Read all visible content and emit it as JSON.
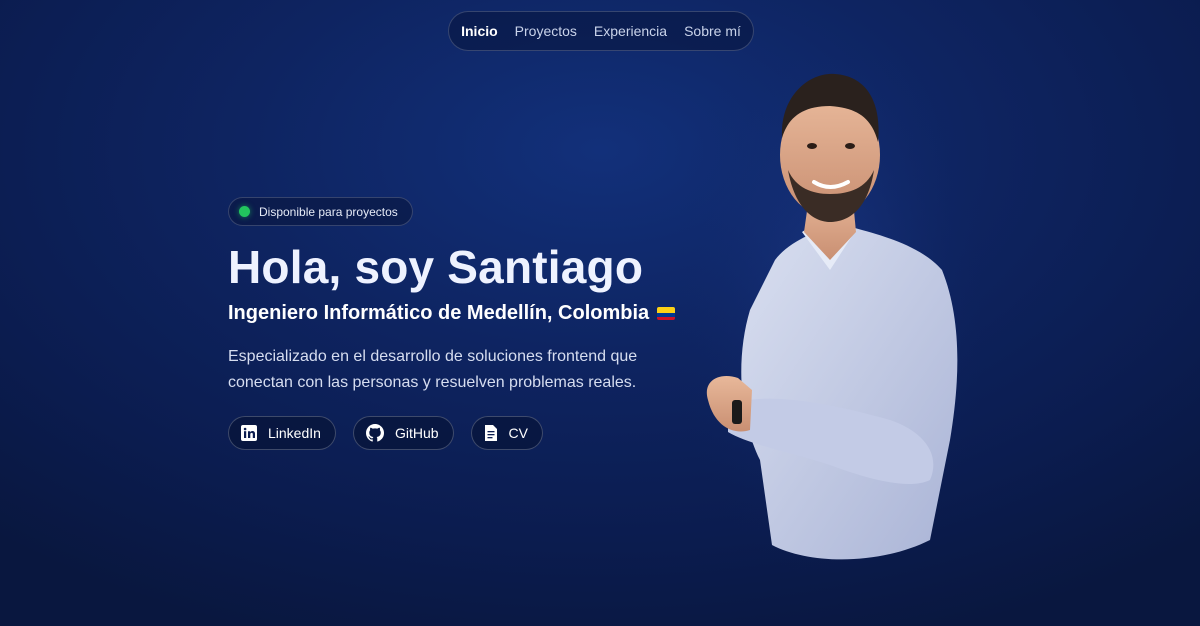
{
  "nav": {
    "items": [
      "Inicio",
      "Proyectos",
      "Experiencia",
      "Sobre mí"
    ],
    "active": "Inicio"
  },
  "hero": {
    "badge": "Disponible para proyectos",
    "title": "Hola, soy Santiago",
    "subtitle": "Ingeniero Informático de Medellín, Colombia",
    "description": "Especializado en el desarrollo de soluciones frontend que conectan con las personas y resuelven problemas reales."
  },
  "links": {
    "linkedin": "LinkedIn",
    "github": "GitHub",
    "cv": "CV"
  },
  "icons": {
    "status": "green-dot-icon",
    "flag": "colombia-flag-icon",
    "linkedin": "linkedin-icon",
    "github": "github-icon",
    "cv": "document-icon"
  },
  "colors": {
    "background": "#0e2461",
    "status_dot": "#22c55e",
    "flag_yellow": "#fcd116",
    "flag_blue": "#003893",
    "flag_red": "#ce1126"
  }
}
